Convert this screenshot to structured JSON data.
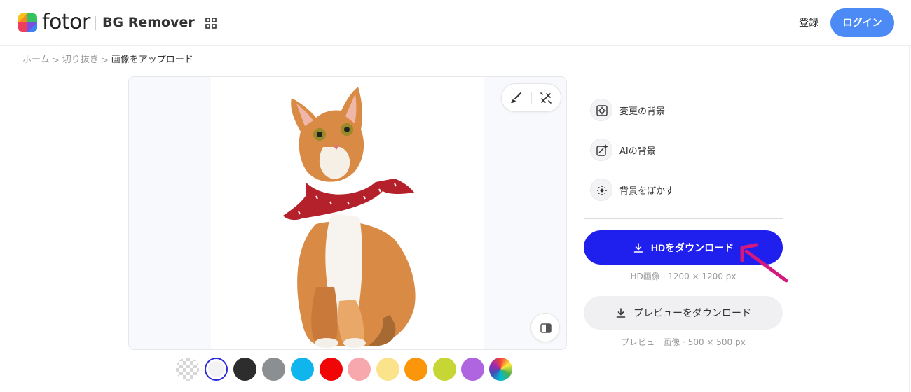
{
  "header": {
    "logo_text": "fotor",
    "product_name": "BG Remover",
    "register_label": "登録",
    "login_label": "ログイン"
  },
  "breadcrumb": {
    "items": [
      "ホーム",
      "切り抜き"
    ],
    "current": "画像をアップロード",
    "separator": ">"
  },
  "editor": {
    "tools": [
      "brush-icon",
      "magic-erase-icon"
    ],
    "compare_icon": "compare-icon",
    "image_subject": "cat-cutout"
  },
  "background_swatches": [
    {
      "name": "transparent",
      "color": "transparent"
    },
    {
      "name": "white",
      "color": "#ffffff",
      "selected": true
    },
    {
      "name": "black",
      "color": "#2d2d2d"
    },
    {
      "name": "gray",
      "color": "#8c8f91"
    },
    {
      "name": "cyan",
      "color": "#0fb5ec"
    },
    {
      "name": "red",
      "color": "#f00606"
    },
    {
      "name": "pink",
      "color": "#f7a8ac"
    },
    {
      "name": "light-yellow",
      "color": "#fbe38c"
    },
    {
      "name": "orange",
      "color": "#fb950a"
    },
    {
      "name": "lime",
      "color": "#c6d634"
    },
    {
      "name": "purple",
      "color": "#b065e0"
    },
    {
      "name": "rainbow",
      "color": "conic"
    }
  ],
  "options": [
    {
      "label": "変更の背景",
      "icon": "change-background-icon"
    },
    {
      "label": "AIの背景",
      "icon": "ai-background-icon"
    },
    {
      "label": "背景をぼかす",
      "icon": "blur-background-icon"
    }
  ],
  "download": {
    "hd_label": "HDをダウンロード",
    "hd_caption": "HD画像 · 1200 × 1200 px",
    "preview_label": "プレビューをダウンロード",
    "preview_caption": "プレビュー画像 · 500 × 500 px"
  },
  "colors": {
    "accent": "#2020ee",
    "login": "#4c8bf5",
    "annotation_arrow": "#d4187e"
  }
}
